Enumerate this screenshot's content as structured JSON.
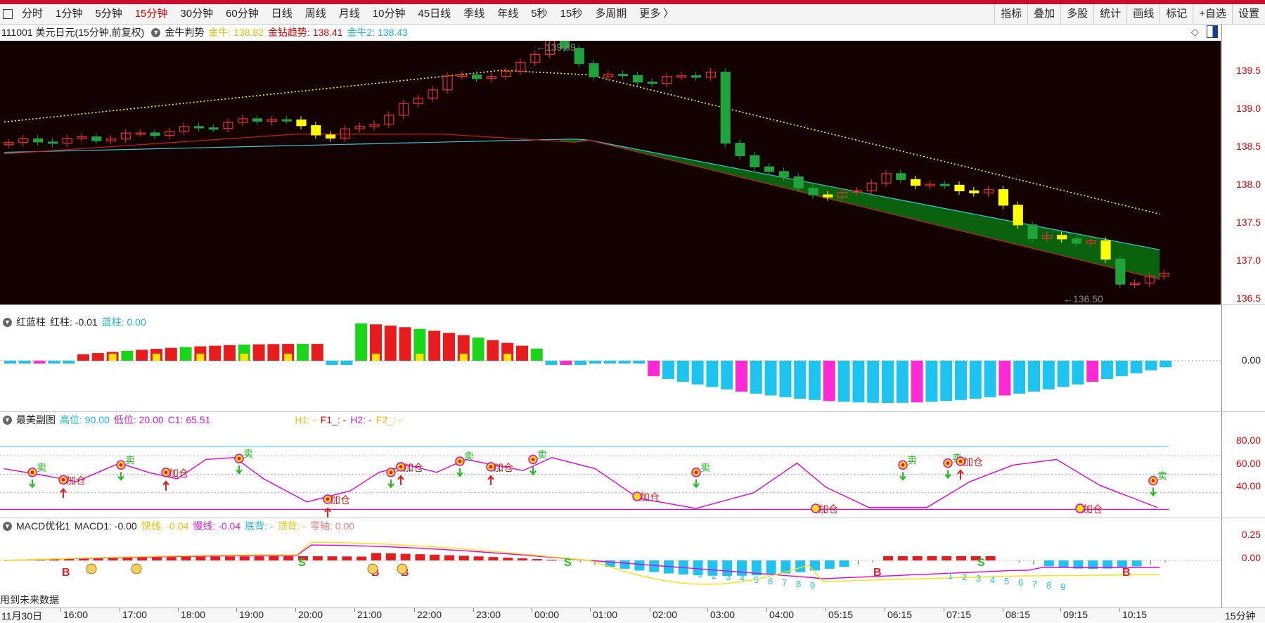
{
  "toolbar": {
    "periods": [
      "分时",
      "1分钟",
      "5分钟",
      "15分钟",
      "30分钟",
      "60分钟",
      "日线",
      "周线",
      "月线",
      "10分钟",
      "45日线",
      "季线",
      "年线",
      "5秒",
      "15秒",
      "多周期",
      "更多 〉"
    ],
    "active_period": "15分钟",
    "tools": [
      "指标",
      "叠加",
      "多股",
      "统计",
      "画线",
      "标记",
      "+自选",
      "设置"
    ]
  },
  "header": {
    "symbol": "111001 美元日元(15分钟,前复权)",
    "indicator": "金牛判势",
    "jin_niu": "金牛: 138.82",
    "jin_zuan": "金钻趋势: 138.41",
    "jin_niu2": "金牛2: 138.43"
  },
  "main_chart": {
    "high_marker": "139.89",
    "low_marker": "136.50",
    "y_labels": [
      "139.5",
      "139.0",
      "138.5",
      "138.0",
      "137.5",
      "137.0",
      "136.5"
    ],
    "colors": {
      "up": "#e8342f",
      "down": "#1fa33a",
      "yellow": "#ffff00",
      "cyan": "#35c9d6",
      "fill": "#0a6b10"
    }
  },
  "panel1": {
    "name": "红蓝柱",
    "red_label": "红柱: -0.01",
    "blue_label": "蓝柱: 0.00",
    "y_labels": [
      "0.00"
    ]
  },
  "panel2": {
    "name": "最美副图",
    "high": "高位: 90.00",
    "low": "低位: 20.00",
    "c1": "C1: 65.51",
    "h1": "H1: -",
    "f1": "F1_: -",
    "h2": "H2: -",
    "f2": "F2_: -",
    "y_labels": [
      "80.00",
      "60.00",
      "40.00"
    ],
    "buy_text": "加仓",
    "sell_text": "卖"
  },
  "panel3": {
    "name": "MACD优化1",
    "macd1": "MACD1: -0.00",
    "fast": "快线: -0.04",
    "slow": "慢线: -0.04",
    "bottom": "底背: -",
    "top": "顶背: -",
    "zero": "零轴: 0.00",
    "y_labels": [
      "0.25",
      "0.00"
    ],
    "footnote": "用到未来数据"
  },
  "x_axis": {
    "labels": [
      "11月30日",
      "16:00",
      "17:00",
      "18:00",
      "19:00",
      "20:00",
      "21:00",
      "22:00",
      "23:00",
      "00:00",
      "01:00",
      "02:00",
      "03:00",
      "04:00",
      "05:15",
      "06:15",
      "07:15",
      "08:15",
      "09:15",
      "10:15"
    ],
    "period": "15分钟"
  }
}
